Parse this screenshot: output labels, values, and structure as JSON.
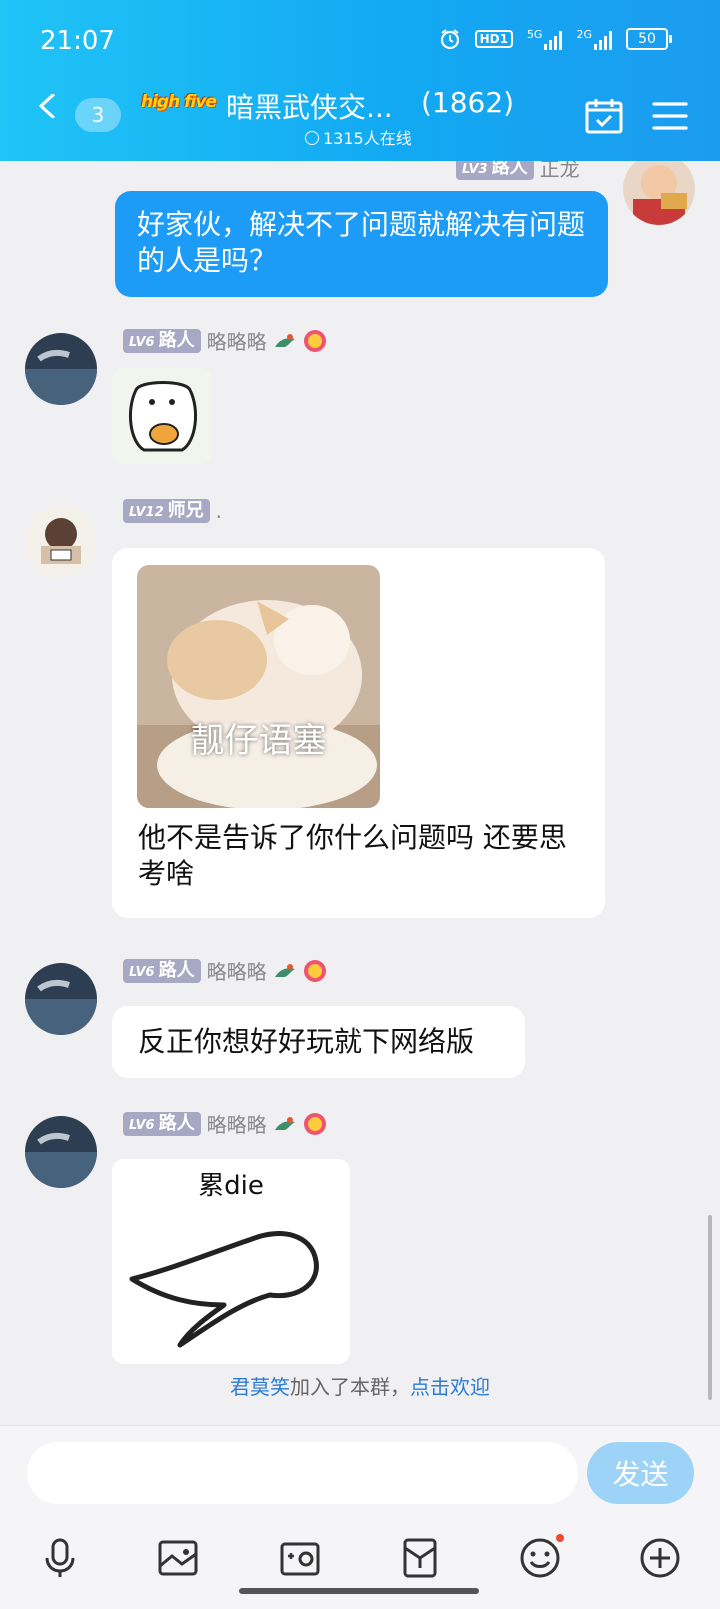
{
  "status_bar": {
    "time": "21:07",
    "hd_label": "HD1",
    "network_a": "5G",
    "network_b": "2G",
    "battery": "50",
    "icons": [
      "alarm-icon",
      "signal-icon",
      "battery-icon"
    ]
  },
  "header": {
    "back_count": "3",
    "logo_text": "high five",
    "title": "暗黑武侠交...",
    "member_count": "(1862)",
    "online": "1315人在线",
    "icons": [
      "back-arrow-icon",
      "calendar-check-icon",
      "menu-icon"
    ]
  },
  "messages": [
    {
      "sender": "me",
      "level": "LV3",
      "title": "路人",
      "name": "正龙",
      "text": "好家伙，解决不了问题就解决有问题的人是吗？"
    },
    {
      "sender": "other",
      "level": "LV6",
      "title": "路人",
      "name": "略略略",
      "type": "sticker",
      "sticker": "bear-sticker"
    },
    {
      "sender": "other",
      "level": "LV12",
      "title": "师兄",
      "name": ".",
      "type": "image+text",
      "image_caption": "靓仔语塞",
      "text": "他不是告诉了你什么问题吗  还要思考啥"
    },
    {
      "sender": "other",
      "level": "LV6",
      "title": "路人",
      "name": "略略略",
      "text": "反正你想好好玩就下网络版"
    },
    {
      "sender": "other",
      "level": "LV6",
      "title": "路人",
      "name": "略略略",
      "type": "sticker",
      "sticker_caption": "累die"
    }
  ],
  "system_message": {
    "user": "君莫笑",
    "middle": "加入了本群，",
    "action": "点击欢迎"
  },
  "input": {
    "placeholder": "",
    "send_label": "发送"
  },
  "toolbar": [
    "microphone-icon",
    "image-icon",
    "camera-icon",
    "red-packet-icon",
    "emoji-icon",
    "plus-icon"
  ],
  "colors": {
    "header_gradient_start": "#20c4f7",
    "header_gradient_end": "#1c9cf0",
    "my_bubble": "#1c9cf6",
    "level_badge": "#a7a8c3",
    "send_button": "#9dd3f7",
    "link_blue": "#2b7cd6",
    "background": "#f0f0f3"
  }
}
